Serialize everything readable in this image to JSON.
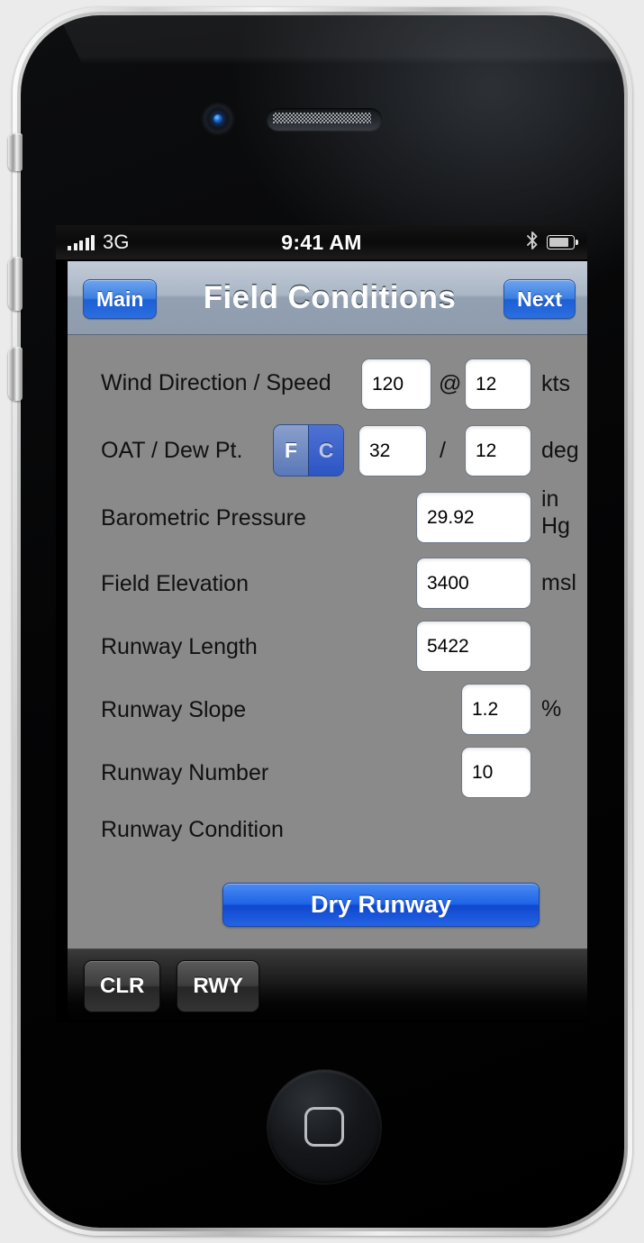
{
  "status_bar": {
    "carrier": "3G",
    "time": "9:41 AM",
    "signal_bars": 5,
    "bluetooth_icon": "bluetooth-icon",
    "battery_icon": "battery-icon"
  },
  "nav_bar": {
    "back_label": "Main",
    "title": "Field Conditions",
    "next_label": "Next"
  },
  "form": {
    "wind": {
      "label": "Wind Direction / Speed",
      "direction_value": "120",
      "separator": "@",
      "speed_value": "12",
      "unit": "kts"
    },
    "temperature": {
      "label": "OAT / Dew Pt.",
      "unit_options": [
        "F",
        "C"
      ],
      "unit_selected": "F",
      "oat_value": "32",
      "separator": "/",
      "dewpoint_value": "12",
      "unit": "deg"
    },
    "barometric_pressure": {
      "label": "Barometric Pressure",
      "value": "29.92",
      "unit_line1": "in",
      "unit_line2": "Hg"
    },
    "field_elevation": {
      "label": "Field Elevation",
      "value": "3400",
      "unit": "msl"
    },
    "runway_length": {
      "label": "Runway Length",
      "value": "5422",
      "unit": ""
    },
    "runway_slope": {
      "label": "Runway Slope",
      "value": "1.2",
      "unit": "%"
    },
    "runway_number": {
      "label": "Runway Number",
      "value": "10",
      "unit": ""
    },
    "runway_condition": {
      "label": "Runway Condition",
      "button_label": "Dry Runway"
    }
  },
  "toolbar": {
    "clear_label": "CLR",
    "runway_label": "RWY"
  },
  "colors": {
    "accent_blue": "#1f64e6",
    "nav_bar_blue_gray": "#aab6c5",
    "content_gray": "#8a8a8a",
    "segment_selected": "#8aa0cc",
    "segment_unselected": "#2c55c4"
  }
}
